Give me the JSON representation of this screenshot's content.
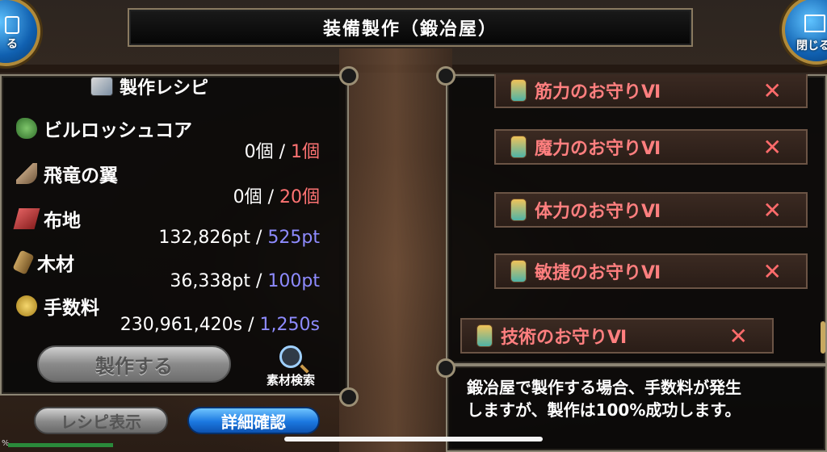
{
  "title": "装備製作（鍛冶屋）",
  "top_left_button": {
    "label": "る",
    "icon": "back-icon"
  },
  "top_right_button": {
    "label": "閉じる",
    "icon": "home-icon"
  },
  "recipe": {
    "header": "製作レシピ",
    "materials": [
      {
        "name": "ビルロッシュコア",
        "have": "0個",
        "sep": " / ",
        "need": "1個",
        "need_color": "#ff7373",
        "icon": "plant-icon"
      },
      {
        "name": "飛竜の翼",
        "have": "0個",
        "sep": " / ",
        "need": "20個",
        "need_color": "#ff7373",
        "icon": "wing-icon"
      },
      {
        "name": "布地",
        "have": "132,826pt",
        "sep": " / ",
        "need": "525pt",
        "need_color": "#8e8bff",
        "icon": "cloth-icon"
      },
      {
        "name": "木材",
        "have": "36,338pt",
        "sep": " / ",
        "need": "100pt",
        "need_color": "#8e8bff",
        "icon": "wood-icon"
      },
      {
        "name": "手数料",
        "have": "230,961,420s",
        "sep": " / ",
        "need": "1,250s",
        "need_color": "#8e8bff",
        "icon": "coin-icon"
      }
    ],
    "make_button": "製作する",
    "search_button": "素材検索"
  },
  "bottom_buttons": {
    "recipe_display": "レシピ表示",
    "detail_confirm": "詳細確認"
  },
  "charm_list": [
    {
      "name": "筋力のお守りⅥ",
      "remove": "✕"
    },
    {
      "name": "魔力のお守りⅥ",
      "remove": "✕"
    },
    {
      "name": "体力のお守りⅥ",
      "remove": "✕"
    },
    {
      "name": "敏捷のお守りⅥ",
      "remove": "✕"
    },
    {
      "name": "技術のお守りⅥ",
      "remove": "✕"
    }
  ],
  "message": {
    "line1": "鍛冶屋で製作する場合、手数料が発生",
    "line2": "しますが、製作は100%成功します。"
  },
  "status": {
    "edge_text": "%"
  }
}
